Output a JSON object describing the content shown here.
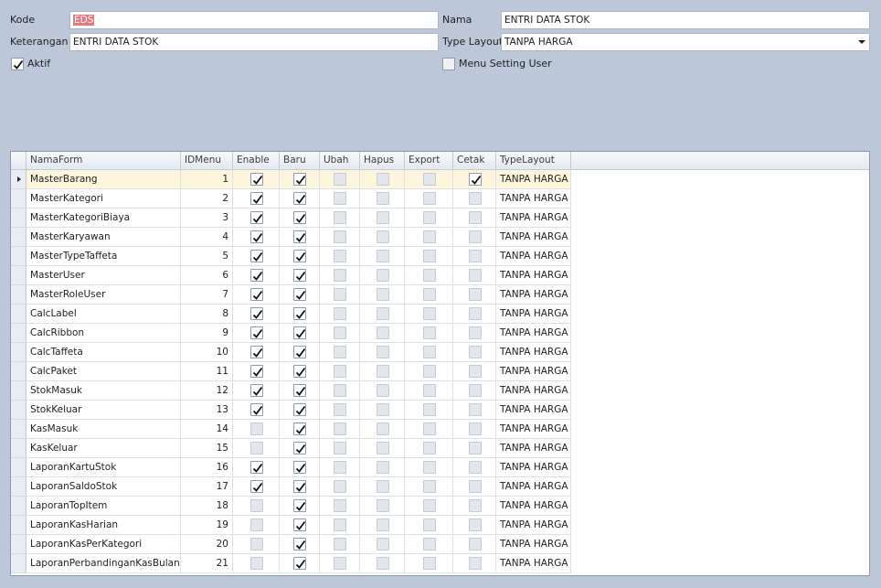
{
  "form": {
    "kode_label": "Kode",
    "kode_value": "EDS",
    "nama_label": "Nama",
    "nama_value": "ENTRI DATA STOK",
    "keterangan_label": "Keterangan",
    "keterangan_value": "ENTRI DATA STOK",
    "type_layout_label": "Type Layout",
    "type_layout_value": "TANPA HARGA",
    "aktif_label": "Aktif",
    "aktif_checked": true,
    "menu_setting_user_label": "Menu Setting User",
    "menu_setting_user_checked": false
  },
  "grid": {
    "columns": [
      "NamaForm",
      "IDMenu",
      "Enable",
      "Baru",
      "Ubah",
      "Hapus",
      "Export",
      "Cetak",
      "TypeLayout"
    ],
    "rows": [
      {
        "nama": "MasterBarang",
        "id": "1",
        "enable": true,
        "baru": true,
        "ubah": false,
        "hapus": false,
        "export": false,
        "cetak": true,
        "type": "TANPA HARGA"
      },
      {
        "nama": "MasterKategori",
        "id": "2",
        "enable": true,
        "baru": true,
        "ubah": false,
        "hapus": false,
        "export": false,
        "cetak": false,
        "type": "TANPA HARGA"
      },
      {
        "nama": "MasterKategoriBiaya",
        "id": "3",
        "enable": true,
        "baru": true,
        "ubah": false,
        "hapus": false,
        "export": false,
        "cetak": false,
        "type": "TANPA HARGA"
      },
      {
        "nama": "MasterKaryawan",
        "id": "4",
        "enable": true,
        "baru": true,
        "ubah": false,
        "hapus": false,
        "export": false,
        "cetak": false,
        "type": "TANPA HARGA"
      },
      {
        "nama": "MasterTypeTaffeta",
        "id": "5",
        "enable": true,
        "baru": true,
        "ubah": false,
        "hapus": false,
        "export": false,
        "cetak": false,
        "type": "TANPA HARGA"
      },
      {
        "nama": "MasterUser",
        "id": "6",
        "enable": true,
        "baru": true,
        "ubah": false,
        "hapus": false,
        "export": false,
        "cetak": false,
        "type": "TANPA HARGA"
      },
      {
        "nama": "MasterRoleUser",
        "id": "7",
        "enable": true,
        "baru": true,
        "ubah": false,
        "hapus": false,
        "export": false,
        "cetak": false,
        "type": "TANPA HARGA"
      },
      {
        "nama": "CalcLabel",
        "id": "8",
        "enable": true,
        "baru": true,
        "ubah": false,
        "hapus": false,
        "export": false,
        "cetak": false,
        "type": "TANPA HARGA"
      },
      {
        "nama": "CalcRibbon",
        "id": "9",
        "enable": true,
        "baru": true,
        "ubah": false,
        "hapus": false,
        "export": false,
        "cetak": false,
        "type": "TANPA HARGA"
      },
      {
        "nama": "CalcTaffeta",
        "id": "10",
        "enable": true,
        "baru": true,
        "ubah": false,
        "hapus": false,
        "export": false,
        "cetak": false,
        "type": "TANPA HARGA"
      },
      {
        "nama": "CalcPaket",
        "id": "11",
        "enable": true,
        "baru": true,
        "ubah": false,
        "hapus": false,
        "export": false,
        "cetak": false,
        "type": "TANPA HARGA"
      },
      {
        "nama": "StokMasuk",
        "id": "12",
        "enable": true,
        "baru": true,
        "ubah": false,
        "hapus": false,
        "export": false,
        "cetak": false,
        "type": "TANPA HARGA"
      },
      {
        "nama": "StokKeluar",
        "id": "13",
        "enable": true,
        "baru": true,
        "ubah": false,
        "hapus": false,
        "export": false,
        "cetak": false,
        "type": "TANPA HARGA"
      },
      {
        "nama": "KasMasuk",
        "id": "14",
        "enable": false,
        "baru": true,
        "ubah": false,
        "hapus": false,
        "export": false,
        "cetak": false,
        "type": "TANPA HARGA"
      },
      {
        "nama": "KasKeluar",
        "id": "15",
        "enable": false,
        "baru": true,
        "ubah": false,
        "hapus": false,
        "export": false,
        "cetak": false,
        "type": "TANPA HARGA"
      },
      {
        "nama": "LaporanKartuStok",
        "id": "16",
        "enable": true,
        "baru": true,
        "ubah": false,
        "hapus": false,
        "export": false,
        "cetak": false,
        "type": "TANPA HARGA"
      },
      {
        "nama": "LaporanSaldoStok",
        "id": "17",
        "enable": true,
        "baru": true,
        "ubah": false,
        "hapus": false,
        "export": false,
        "cetak": false,
        "type": "TANPA HARGA"
      },
      {
        "nama": "LaporanTopItem",
        "id": "18",
        "enable": false,
        "baru": true,
        "ubah": false,
        "hapus": false,
        "export": false,
        "cetak": false,
        "type": "TANPA HARGA"
      },
      {
        "nama": "LaporanKasHarian",
        "id": "19",
        "enable": false,
        "baru": true,
        "ubah": false,
        "hapus": false,
        "export": false,
        "cetak": false,
        "type": "TANPA HARGA"
      },
      {
        "nama": "LaporanKasPerKategori",
        "id": "20",
        "enable": false,
        "baru": true,
        "ubah": false,
        "hapus": false,
        "export": false,
        "cetak": false,
        "type": "TANPA HARGA"
      },
      {
        "nama": "LaporanPerbandinganKasBulanan",
        "id": "21",
        "enable": false,
        "baru": true,
        "ubah": false,
        "hapus": false,
        "export": false,
        "cetak": false,
        "type": "TANPA HARGA"
      }
    ]
  },
  "colors": {
    "background": "#bcc8d9",
    "focused_row": "#fdf6dc",
    "selected_text": "#e8787a"
  }
}
